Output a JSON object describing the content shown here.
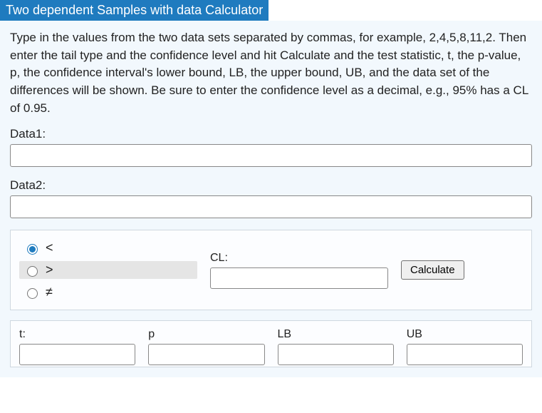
{
  "header": {
    "title": "Two dependent Samples with data Calculator"
  },
  "intro": "Type in the values from the two data sets separated by commas, for example, 2,4,5,8,11,2.  Then enter the tail type and the confidence level and hit Calculate and the test statistic, t, the p-value, p, the confidence interval's lower bound, LB, the upper bound, UB, and the data set of the differences will be shown.  Be sure to enter the confidence level as a decimal, e.g., 95% has a CL of 0.95.",
  "fields": {
    "data1_label": "Data1:",
    "data1_value": "",
    "data2_label": "Data2:",
    "data2_value": ""
  },
  "tail": {
    "options": {
      "lt": "<",
      "gt": ">",
      "ne": "≠"
    },
    "selected": "lt"
  },
  "cl": {
    "label": "CL:",
    "value": ""
  },
  "buttons": {
    "calculate": "Calculate"
  },
  "results": {
    "t_label": "t:",
    "t_value": "",
    "p_label": "p",
    "p_value": "",
    "lb_label": "LB",
    "lb_value": "",
    "ub_label": "UB",
    "ub_value": ""
  }
}
